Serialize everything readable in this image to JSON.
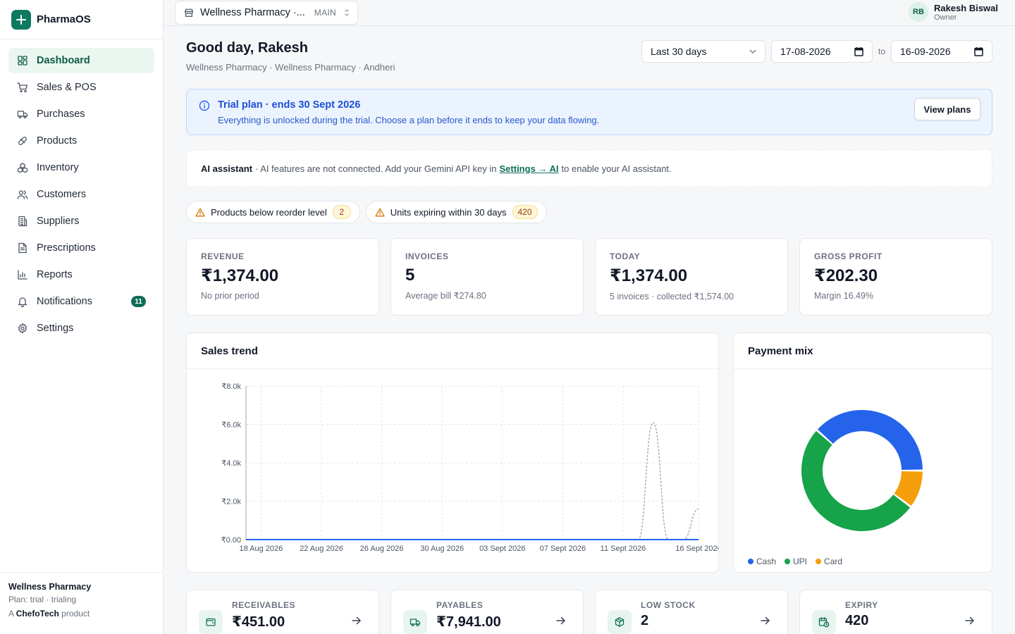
{
  "app": {
    "name": "PharmaOS"
  },
  "sidebar": {
    "items": [
      {
        "label": "Dashboard",
        "icon": "dashboard-icon"
      },
      {
        "label": "Sales & POS",
        "icon": "cart-icon"
      },
      {
        "label": "Purchases",
        "icon": "truck-icon"
      },
      {
        "label": "Products",
        "icon": "pill-icon"
      },
      {
        "label": "Inventory",
        "icon": "boxes-icon"
      },
      {
        "label": "Customers",
        "icon": "users-icon"
      },
      {
        "label": "Suppliers",
        "icon": "building-icon"
      },
      {
        "label": "Prescriptions",
        "icon": "file-icon"
      },
      {
        "label": "Reports",
        "icon": "bar-chart-icon"
      },
      {
        "label": "Notifications",
        "icon": "bell-icon",
        "badge": "11"
      },
      {
        "label": "Settings",
        "icon": "gear-icon"
      }
    ],
    "footer": {
      "store": "Wellness Pharmacy",
      "plan": "Plan: trial · trialing",
      "made_prefix": "A",
      "brand": "ChefoTech",
      "made_suffix": "product"
    }
  },
  "topbar": {
    "store": "Wellness Pharmacy ·...",
    "store_tag": "MAIN",
    "user": {
      "initials": "RB",
      "name": "Rakesh Biswal",
      "role": "Owner"
    }
  },
  "header": {
    "greeting": "Good day, Rakesh",
    "subtitle": "Wellness Pharmacy · Wellness Pharmacy · Andheri",
    "range": "Last 30 days",
    "date_from": "17-08-2026",
    "to_label": "to",
    "date_to": "16-09-2026"
  },
  "trial": {
    "title": "Trial plan · ends 30 Sept 2026",
    "text": "Everything is unlocked during the trial. Choose a plan before it ends to keep your data flowing.",
    "button": "View plans"
  },
  "ai": {
    "label": "AI assistant",
    "text_before": "· AI features are not connected. Add your Gemini API key in",
    "link": "Settings → AI",
    "text_after": "to enable your AI assistant."
  },
  "alerts": [
    {
      "label": "Products below reorder level",
      "count": "2"
    },
    {
      "label": "Units expiring within 30 days",
      "count": "420"
    }
  ],
  "kpis": [
    {
      "label": "REVENUE",
      "value": "₹1,374.00",
      "sub": "No prior period"
    },
    {
      "label": "INVOICES",
      "value": "5",
      "sub": "Average bill ₹274.80"
    },
    {
      "label": "TODAY",
      "value": "₹1,374.00",
      "sub": "5 invoices · collected ₹1,574.00"
    },
    {
      "label": "GROSS PROFIT",
      "value": "₹202.30",
      "sub": "Margin 16.49%"
    }
  ],
  "sales_trend": {
    "title": "Sales trend"
  },
  "payment_mix": {
    "title": "Payment mix"
  },
  "bottom_cards": [
    {
      "label": "RECEIVABLES",
      "value": "₹451.00",
      "icon": "wallet-icon"
    },
    {
      "label": "PAYABLES",
      "value": "₹7,941.00",
      "icon": "truck-icon"
    },
    {
      "label": "LOW STOCK",
      "value": "2",
      "icon": "package-icon"
    },
    {
      "label": "EXPIRY",
      "value": "420",
      "icon": "calendar-clock-icon"
    }
  ],
  "colors": {
    "brand": "#0f7a5f",
    "cash": "#2563eb",
    "upi": "#16a34a",
    "card": "#f59e0b"
  },
  "chart_data": [
    {
      "type": "line",
      "title": "Sales trend",
      "x": [
        "17 Aug 2026",
        "18 Aug 2026",
        "19 Aug 2026",
        "20 Aug 2026",
        "21 Aug 2026",
        "22 Aug 2026",
        "23 Aug 2026",
        "24 Aug 2026",
        "25 Aug 2026",
        "26 Aug 2026",
        "27 Aug 2026",
        "28 Aug 2026",
        "29 Aug 2026",
        "30 Aug 2026",
        "31 Aug 2026",
        "01 Sept 2026",
        "02 Sept 2026",
        "03 Sept 2026",
        "04 Sept 2026",
        "05 Sept 2026",
        "06 Sept 2026",
        "07 Sept 2026",
        "08 Sept 2026",
        "09 Sept 2026",
        "10 Sept 2026",
        "11 Sept 2026",
        "12 Sept 2026",
        "13 Sept 2026",
        "14 Sept 2026",
        "15 Sept 2026",
        "16 Sept 2026"
      ],
      "x_tick_labels": [
        "18 Aug 2026",
        "22 Aug 2026",
        "26 Aug 2026",
        "30 Aug 2026",
        "03 Sept 2026",
        "07 Sept 2026",
        "11 Sept 2026",
        "16 Sept 2026"
      ],
      "y_tick_labels": [
        "₹0.00",
        "₹2.0k",
        "₹4.0k",
        "₹6.0k",
        "₹8.0k"
      ],
      "ylim": [
        0,
        8000
      ],
      "grid": true,
      "series": [
        {
          "style": "solid",
          "color": "#2563eb",
          "values": [
            0,
            0,
            0,
            0,
            0,
            0,
            0,
            0,
            0,
            0,
            0,
            0,
            0,
            0,
            0,
            0,
            0,
            0,
            0,
            0,
            0,
            0,
            0,
            0,
            0,
            0,
            0,
            0,
            0,
            0,
            0
          ]
        },
        {
          "style": "dashed",
          "color": "#9ca3af",
          "values": [
            0,
            0,
            0,
            0,
            0,
            0,
            0,
            0,
            0,
            0,
            0,
            0,
            0,
            0,
            0,
            0,
            0,
            0,
            0,
            0,
            0,
            0,
            0,
            0,
            0,
            0,
            0,
            6100,
            0,
            0,
            1600
          ]
        }
      ]
    },
    {
      "type": "pie",
      "title": "Payment mix",
      "legend_position": "bottom-left",
      "labels": [
        "Cash",
        "UPI",
        "Card"
      ],
      "values": [
        604,
        810,
        160
      ]
    }
  ]
}
